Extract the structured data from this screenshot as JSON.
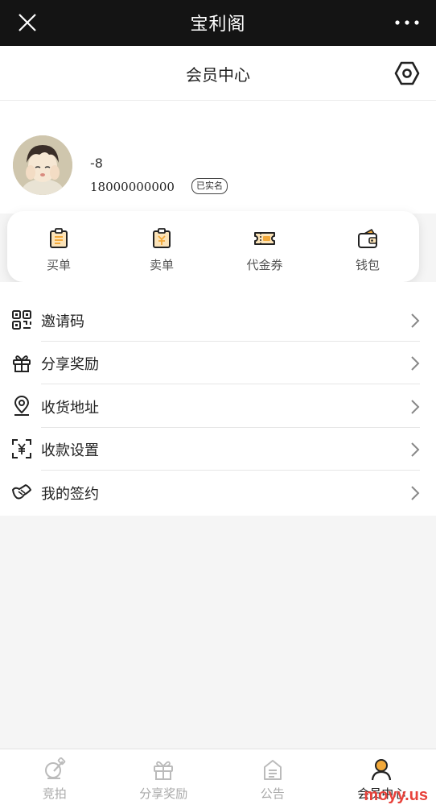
{
  "window": {
    "title": "宝利阁",
    "close_icon": "close-icon",
    "more_icon": "more-dots-icon"
  },
  "header": {
    "title": "会员中心",
    "settings_icon": "settings-hex-icon"
  },
  "profile": {
    "nickname": "-8",
    "phone": "18000000000",
    "verified_badge": "已实名"
  },
  "orders": [
    {
      "label": "买单",
      "icon": "buy-order-icon"
    },
    {
      "label": "卖单",
      "icon": "sell-order-icon"
    },
    {
      "label": "代金券",
      "icon": "voucher-icon"
    },
    {
      "label": "钱包",
      "icon": "wallet-icon"
    }
  ],
  "menu": [
    {
      "label": "邀请码",
      "icon": "qr-code-icon"
    },
    {
      "label": "分享奖励",
      "icon": "gift-icon"
    },
    {
      "label": "收货地址",
      "icon": "location-pin-icon"
    },
    {
      "label": "收款设置",
      "icon": "yuan-scan-icon"
    },
    {
      "label": "我的签约",
      "icon": "handshake-icon"
    }
  ],
  "tabbar": [
    {
      "label": "竞拍",
      "icon": "auction-icon",
      "active": false
    },
    {
      "label": "分享奖励",
      "icon": "gift-icon",
      "active": false
    },
    {
      "label": "公告",
      "icon": "notice-icon",
      "active": false
    },
    {
      "label": "会员中心",
      "icon": "member-icon",
      "active": true
    }
  ],
  "colors": {
    "accent": "#f2a93b",
    "topbar": "#141414",
    "watermark": "#e8423b"
  },
  "watermark": "moyy.us"
}
